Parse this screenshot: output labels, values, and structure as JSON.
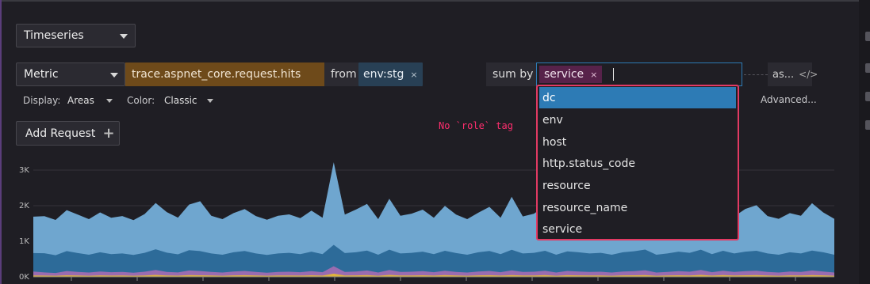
{
  "widget_type": {
    "value": "Timeseries"
  },
  "query": {
    "source_type": "Metric",
    "metric": "trace.aspnet_core.request.hits",
    "from_label": "from",
    "from_tags": [
      "env:stg"
    ],
    "sumby_label": "sum by",
    "sumby_tags": [
      "service"
    ],
    "as_label": "as...",
    "code_icon": "</>",
    "remove_icon": "×"
  },
  "display": {
    "label": "Display:",
    "value": "Areas"
  },
  "color": {
    "label": "Color:",
    "value": "Classic"
  },
  "advanced": "Advanced...",
  "add_request": {
    "label": "Add Request",
    "icon": "+"
  },
  "dropdown": {
    "options": [
      "dc",
      "env",
      "host",
      "http.status_code",
      "resource",
      "resource_name",
      "service"
    ],
    "highlighted": "dc",
    "highlight_color": "#e23a63"
  },
  "annotation": "No `role` tag",
  "chart_data": {
    "type": "area",
    "stacked": true,
    "y_ticks": [
      "3K",
      "2K",
      "1K",
      "0K"
    ],
    "ylim": [
      0,
      3000
    ],
    "series": [
      {
        "color": "#6fa6cf",
        "values": [
          1020,
          1040,
          990,
          1150,
          1080,
          1000,
          1120,
          1020,
          1050,
          980,
          1090,
          1300,
          1140,
          1030,
          1280,
          1400,
          1060,
          1000,
          1100,
          1180,
          1050,
          990,
          1060,
          1080,
          1010,
          1150,
          1020,
          2320,
          1080,
          1200,
          1310,
          1000,
          1430,
          1060,
          1100,
          1180,
          1020,
          1260,
          1080,
          1000,
          1110,
          1240,
          1020,
          1490,
          1040,
          1100,
          1260,
          1000,
          1230,
          1140,
          1080,
          1090,
          1010,
          1120,
          1180,
          1440,
          1010,
          1050,
          1170,
          1090,
          1450,
          1020,
          1280,
          1040,
          1200,
          1280,
          1050,
          1010,
          1100,
          1060,
          1330,
          1120,
          1010
        ]
      },
      {
        "color": "#2d6b99",
        "values": [
          520,
          540,
          500,
          560,
          530,
          500,
          540,
          510,
          520,
          500,
          530,
          580,
          540,
          510,
          570,
          560,
          520,
          500,
          540,
          560,
          520,
          500,
          520,
          530,
          510,
          550,
          510,
          600,
          530,
          540,
          560,
          500,
          570,
          520,
          530,
          550,
          510,
          560,
          530,
          500,
          540,
          560,
          510,
          580,
          520,
          530,
          560,
          500,
          550,
          540,
          520,
          530,
          500,
          540,
          560,
          580,
          500,
          520,
          550,
          530,
          570,
          510,
          560,
          520,
          550,
          560,
          520,
          500,
          540,
          520,
          560,
          540,
          500
        ]
      },
      {
        "color": "#9a6cb0",
        "values": [
          110,
          90,
          80,
          120,
          100,
          90,
          110,
          95,
          100,
          85,
          105,
          140,
          100,
          90,
          130,
          120,
          100,
          90,
          110,
          120,
          100,
          85,
          100,
          105,
          95,
          115,
          95,
          210,
          100,
          110,
          130,
          90,
          140,
          100,
          105,
          115,
          95,
          125,
          100,
          90,
          110,
          120,
          95,
          130,
          100,
          105,
          125,
          90,
          120,
          110,
          100,
          105,
          90,
          110,
          115,
          135,
          90,
          100,
          115,
          105,
          140,
          95,
          125,
          100,
          115,
          125,
          100,
          90,
          110,
          100,
          130,
          110,
          90
        ]
      },
      {
        "color": "#e0b43c",
        "values": [
          40,
          35,
          30,
          45,
          38,
          32,
          42,
          36,
          38,
          30,
          40,
          55,
          40,
          34,
          50,
          45,
          38,
          32,
          42,
          46,
          38,
          30,
          38,
          40,
          35,
          44,
          35,
          90,
          38,
          42,
          50,
          32,
          55,
          38,
          40,
          44,
          36,
          48,
          38,
          32,
          42,
          46,
          36,
          52,
          38,
          40,
          48,
          32,
          46,
          42,
          38,
          40,
          32,
          42,
          44,
          52,
          32,
          38,
          44,
          40,
          55,
          36,
          48,
          38,
          44,
          48,
          38,
          32,
          42,
          38,
          50,
          42,
          32
        ]
      }
    ]
  }
}
